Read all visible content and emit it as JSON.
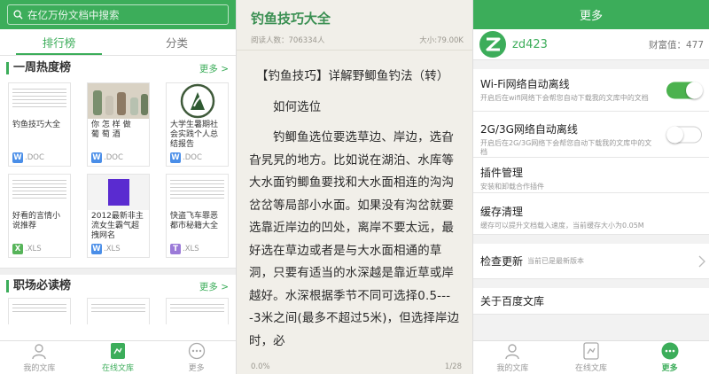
{
  "library": {
    "search_placeholder": "在亿万份文档中搜索",
    "tabs": [
      "排行榜",
      "分类"
    ],
    "section1": {
      "title": "一周热度榜",
      "more": "更多 >"
    },
    "cards": [
      {
        "title": "钓鱼技巧大全",
        "ext": ".DOC",
        "badge": "W",
        "type": "w"
      },
      {
        "title": "葡 萄 酒",
        "ext": ".DOC",
        "badge": "W",
        "type": "w",
        "thumb_caption": "你 怎 样 做"
      },
      {
        "title": "大学生暑期社会实践个人总结报告",
        "ext": ".DOC",
        "badge": "W",
        "type": "w"
      },
      {
        "title": "好看的言情小说推荐",
        "ext": ".XLS",
        "badge": "X",
        "type": "x"
      },
      {
        "title": "2012最新非主流女生霸气超拽网名",
        "ext": ".XLS",
        "badge": "W",
        "type": "w"
      },
      {
        "title": "快盗飞车罪恶都市秘籍大全",
        "ext": ".XLS",
        "badge": "T",
        "type": "t"
      }
    ],
    "section2": {
      "title": "职场必读榜",
      "more": "更多 >"
    },
    "nav": [
      "我的文库",
      "在线文库",
      "更多"
    ]
  },
  "reader": {
    "title": "钓鱼技巧大全",
    "readers": "阅读人数：706334人",
    "size": "大小:79.00K",
    "paragraphs": [
      "【钓鱼技巧】详解野鲫鱼钓法（转）",
      "如何选位",
      "钓鲫鱼选位要选草边、岸边，选旮旮旯旯的地方。比如说在湖泊、水库等大水面钓鲫鱼要找和大水面相连的沟沟岔岔等局部小水面。如果没有沟岔就要选靠近岸边的凹处，离岸不要太远，最好选在草边或者是与大水面相通的草洞，只要有适当的水深越是靠近草或岸越好。水深根据季节不同可选择0.5----3米之间(最多不超过5米)，但选择岸边时，必"
    ],
    "progress": "0.0%",
    "page": "1/28"
  },
  "more": {
    "title": "更多",
    "username": "zd423",
    "wealth": "财富值：477",
    "rows": [
      {
        "title": "Wi-Fi网络自动离线",
        "sub": "开启后在wifi网络下会帮您自动下载我的文库中的文档"
      },
      {
        "title": "2G/3G网络自动离线",
        "sub": "开启后在2G/3G网络下会帮您自动下载我的文库中的文档"
      },
      {
        "title": "插件管理",
        "sub": "安装和卸载合作插件"
      },
      {
        "title": "缓存清理",
        "sub": "缓存可以提升文档载入速度，当前缓存大小为0.05M"
      },
      {
        "title": "检查更新",
        "note": "当前已是最新版本"
      },
      {
        "title": "关于百度文库"
      }
    ],
    "wifi_toggle_on": true,
    "cell_toggle_on": false,
    "nav": [
      "我的文库",
      "在线文库",
      "更多"
    ]
  },
  "colors": {
    "brand_green": "#3cad5a",
    "reader_bg": "#f1efe9"
  }
}
